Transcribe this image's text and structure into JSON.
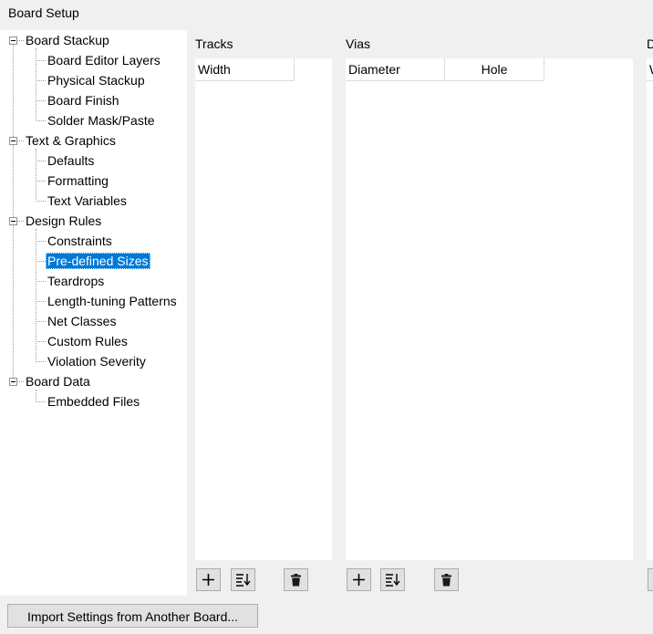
{
  "window": {
    "title": "Board Setup"
  },
  "tree": {
    "groups": [
      {
        "label": "Board Stackup",
        "children": [
          "Board Editor Layers",
          "Physical Stackup",
          "Board Finish",
          "Solder Mask/Paste"
        ]
      },
      {
        "label": "Text & Graphics",
        "children": [
          "Defaults",
          "Formatting",
          "Text Variables"
        ]
      },
      {
        "label": "Design Rules",
        "children": [
          "Constraints",
          "Pre-defined Sizes",
          "Teardrops",
          "Length-tuning Patterns",
          "Net Classes",
          "Custom Rules",
          "Violation Severity"
        ]
      },
      {
        "label": "Board Data",
        "children": [
          "Embedded Files"
        ]
      }
    ],
    "selected": "Pre-defined Sizes"
  },
  "tracks": {
    "title": "Tracks",
    "columns": [
      "Width"
    ]
  },
  "vias": {
    "title": "Vias",
    "columns": [
      "Diameter",
      "Hole"
    ]
  },
  "third_section": {
    "title": "D",
    "columns": [
      "W"
    ]
  },
  "buttons": {
    "import": "Import Settings from Another Board..."
  },
  "icons": {
    "add": "plus-icon",
    "sort": "sort-icon",
    "delete": "trash-icon"
  },
  "colors": {
    "selection": "#0078d7",
    "background": "#f0f0f0"
  }
}
